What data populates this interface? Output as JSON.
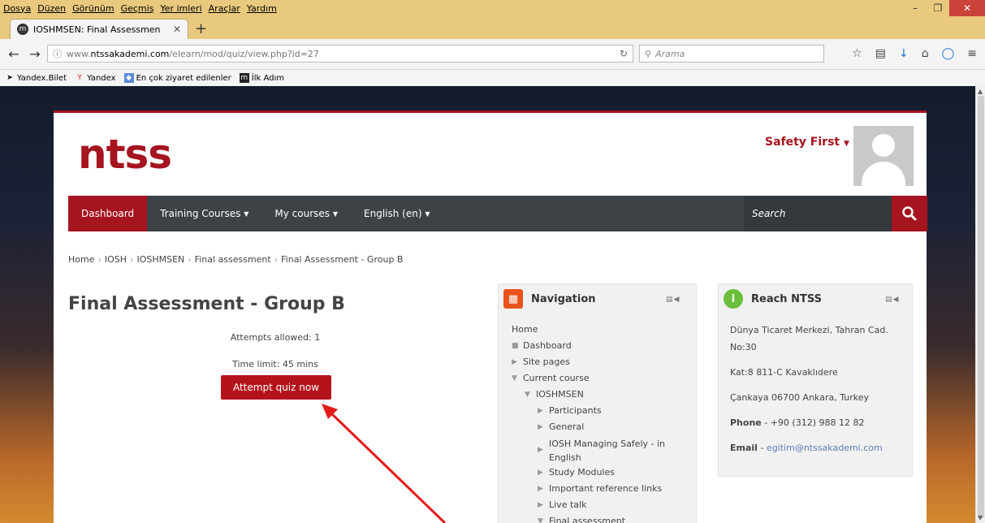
{
  "browser": {
    "menu": [
      "Dosya",
      "Düzen",
      "Görünüm",
      "Geçmiş",
      "Yer imleri",
      "Araçlar",
      "Yardım"
    ],
    "tab_title": "IOSHMSEN: Final Assessmen",
    "url_prefix": "www.",
    "url_domain": "ntssakademi.com",
    "url_path": "/elearn/mod/quiz/view.php?id=27",
    "search_placeholder": "Arama",
    "bookmarks": [
      "Yandex.Bilet",
      "Yandex",
      "En çok ziyaret edilenler",
      "İlk Adım"
    ]
  },
  "site": {
    "logo": "ntss",
    "user_name": "Safety First",
    "nav": {
      "dashboard": "Dashboard",
      "training": "Training Courses",
      "mycourses": "My courses",
      "language": "English (en)",
      "search_placeholder": "Search"
    },
    "breadcrumb": [
      "Home",
      "IOSH",
      "IOSHMSEN",
      "Final assessment",
      "Final Assessment - Group B"
    ]
  },
  "quiz": {
    "title": "Final Assessment - Group B",
    "attempts": "Attempts allowed: 1",
    "time_limit": "Time limit: 45 mins",
    "button": "Attempt quiz now"
  },
  "navigation_block": {
    "title": "Navigation",
    "items": {
      "home": "Home",
      "dashboard": "Dashboard",
      "site_pages": "Site pages",
      "current_course": "Current course",
      "course": "IOSHMSEN",
      "participants": "Participants",
      "general": "General",
      "managing_1": "IOSH Managing Safely - in",
      "managing_2": "English",
      "study": "Study Modules",
      "reference": "Important reference links",
      "live_talk": "Live talk",
      "final": "Final assessment"
    }
  },
  "reach_block": {
    "title": "Reach NTSS",
    "address_1": "Dünya Ticaret Merkezi, Tahran Cad. No:30",
    "address_2": "Kat:8 811-C Kavaklıdere",
    "address_3": "Çankaya 06700 Ankara, Turkey",
    "phone_label": "Phone",
    "phone": " - +90 (312) 988 12 82",
    "email_label": "Email",
    "email": "egitim@ntssakademi.com"
  },
  "colors": {
    "brand_red": "#a5141f",
    "nav_dark": "#3c4246",
    "annotation_arrow": "#e31b1b"
  }
}
